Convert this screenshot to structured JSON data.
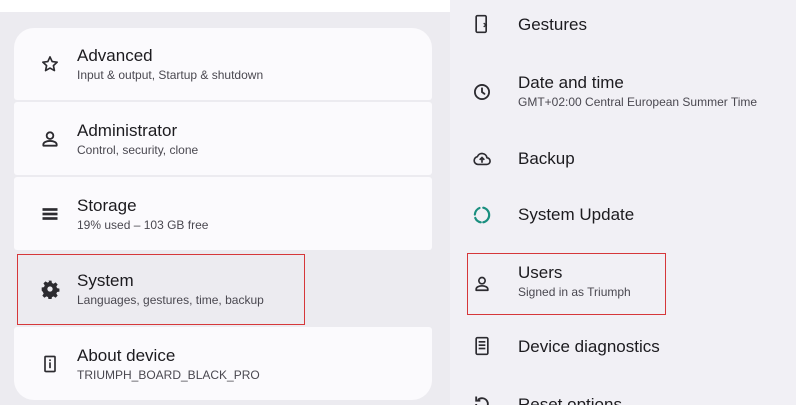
{
  "left_panel": {
    "items": [
      {
        "title": "Advanced",
        "subtitle": "Input & output, Startup & shutdown",
        "icon": "star-outline-icon"
      },
      {
        "title": "Administrator",
        "subtitle": "Control, security, clone",
        "icon": "admin-person-icon"
      },
      {
        "title": "Storage",
        "subtitle": "19% used – 103 GB free",
        "icon": "storage-icon"
      },
      {
        "title": "System",
        "subtitle": "Languages, gestures, time, backup",
        "icon": "gear-icon",
        "selected": true
      },
      {
        "title": "About device",
        "subtitle": "TRIUMPH_BOARD_BLACK_PRO",
        "icon": "device-info-icon"
      }
    ]
  },
  "right_panel": {
    "items": [
      {
        "title": "Gestures",
        "icon": "gestures-phone-icon"
      },
      {
        "title": "Date and time",
        "subtitle": "GMT+02:00 Central European Summer Time",
        "icon": "clock-icon"
      },
      {
        "title": "Backup",
        "icon": "cloud-backup-icon"
      },
      {
        "title": "System Update",
        "icon": "system-update-icon"
      },
      {
        "title": "Users",
        "subtitle": "Signed in as Triumph",
        "icon": "user-icon"
      },
      {
        "title": "Device diagnostics",
        "icon": "diagnostics-icon"
      },
      {
        "title": "Reset options",
        "icon": "reset-icon"
      }
    ]
  },
  "colors": {
    "highlight": "#d6373a",
    "update_icon": "#1a8f7f",
    "text_primary": "#1c1b1f",
    "text_secondary": "#4a4850"
  }
}
